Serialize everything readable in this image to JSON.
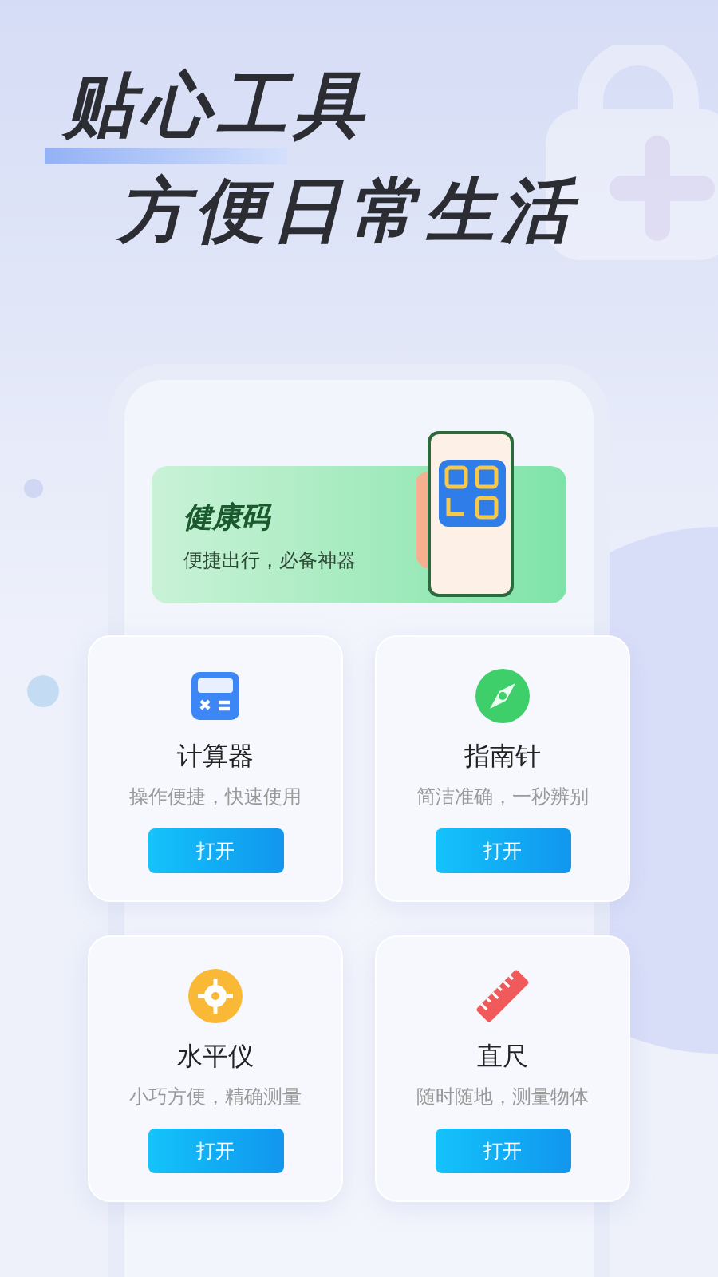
{
  "headline": {
    "line_1": "贴心工具",
    "line_2": "方便日常生活"
  },
  "banner": {
    "title": "健康码",
    "subtitle": "便捷出行，必备神器"
  },
  "tools": [
    {
      "kind": "calculator",
      "name": "计算器",
      "description": "操作便捷，快速使用",
      "button": "打开"
    },
    {
      "kind": "compass",
      "name": "指南针",
      "description": "简洁准确，一秒辨别",
      "button": "打开"
    },
    {
      "kind": "level",
      "name": "水平仪",
      "description": "小巧方便，精确测量",
      "button": "打开"
    },
    {
      "kind": "ruler",
      "name": "直尺",
      "description": "随时随地，测量物体",
      "button": "打开"
    }
  ]
}
